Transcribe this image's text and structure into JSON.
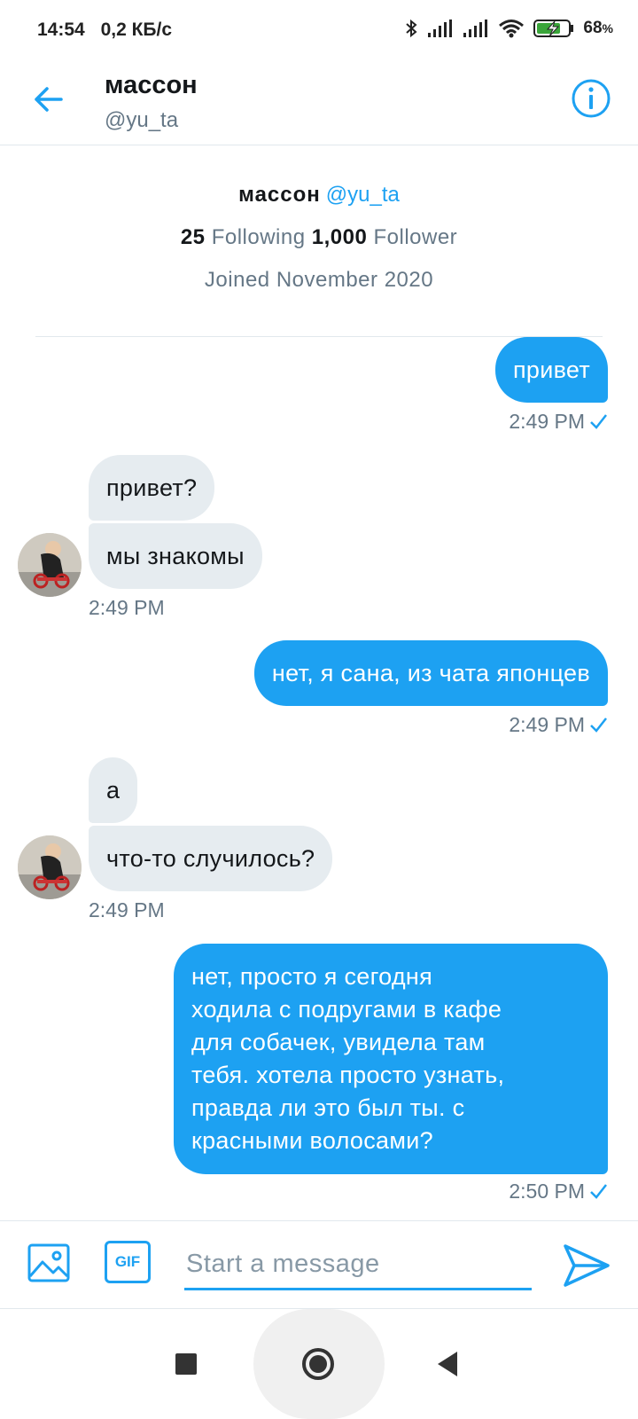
{
  "status_bar": {
    "time": "14:54",
    "speed": "0,2 КБ/с",
    "battery_percent": "68",
    "battery_unit": "%"
  },
  "header": {
    "name": "массон",
    "handle": "@yu_ta"
  },
  "profile": {
    "name": "массон",
    "handle": "@yu_ta",
    "following_count": "25",
    "following_label": "Following",
    "follower_count": "1,000",
    "follower_label": "Follower",
    "joined": "Joined November 2020"
  },
  "messages": [
    {
      "side": "sent",
      "text": "привет",
      "time": "2:49 PM"
    },
    {
      "side": "received",
      "text": "привет?"
    },
    {
      "side": "received",
      "text": "мы знакомы",
      "time": "2:49 PM"
    },
    {
      "side": "sent",
      "text": "нет, я сана, из чата японцев",
      "time": "2:49 PM"
    },
    {
      "side": "received",
      "text": "а"
    },
    {
      "side": "received",
      "text": "что-то случилось?",
      "time": "2:49 PM"
    },
    {
      "side": "sent",
      "text_lines": [
        "нет, просто я сегодня",
        "ходила с подругами в кафе",
        "для собачек, увидела там",
        "тебя. хотела просто узнать,",
        "правда ли это был ты. с",
        "красными волосами?"
      ],
      "time": "2:50 PM"
    }
  ],
  "composer": {
    "gif_label": "GIF",
    "placeholder": "Start a message"
  },
  "colors": {
    "accent": "#1da1f2",
    "received_bubble": "#e6ecf0",
    "secondary_text": "#657786"
  },
  "icons": {
    "back": "arrow-left-icon",
    "info": "info-icon",
    "image": "image-icon",
    "send": "send-icon"
  }
}
